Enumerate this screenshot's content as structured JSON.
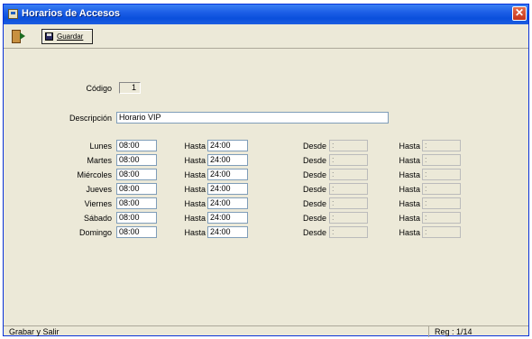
{
  "window": {
    "title": "Horarios de Accesos"
  },
  "toolbar": {
    "save_label": "Guardar"
  },
  "form": {
    "codigo_label": "Código",
    "codigo_value": "1",
    "descripcion_label": "Descripción",
    "descripcion_value": "Horario VIP",
    "hasta_label": "Hasta",
    "desde_label": "Desde",
    "days": [
      {
        "label": "Lunes",
        "from": "08:00",
        "to": "24:00",
        "desde2": " :",
        "hasta2": " :"
      },
      {
        "label": "Martes",
        "from": "08:00",
        "to": "24:00",
        "desde2": " :",
        "hasta2": " :"
      },
      {
        "label": "Miércoles",
        "from": "08:00",
        "to": "24:00",
        "desde2": " :",
        "hasta2": " :"
      },
      {
        "label": "Jueves",
        "from": "08:00",
        "to": "24:00",
        "desde2": " :",
        "hasta2": " :"
      },
      {
        "label": "Viernes",
        "from": "08:00",
        "to": "24:00",
        "desde2": " :",
        "hasta2": " :"
      },
      {
        "label": "Sábado",
        "from": "08:00",
        "to": "24:00",
        "desde2": " :",
        "hasta2": " :"
      },
      {
        "label": "Domingo",
        "from": "08:00",
        "to": "24:00",
        "desde2": " :",
        "hasta2": " :"
      }
    ]
  },
  "statusbar": {
    "left": "Grabar y Salir",
    "right": "Reg : 1/14"
  },
  "colors": {
    "titlebar": "#0a4fdc",
    "window_bg": "#ece9d8",
    "close": "#c4331a"
  },
  "icons": {
    "app": "form-icon",
    "exit": "exit-door-icon",
    "save": "floppy-disk-icon",
    "close": "close-icon"
  }
}
